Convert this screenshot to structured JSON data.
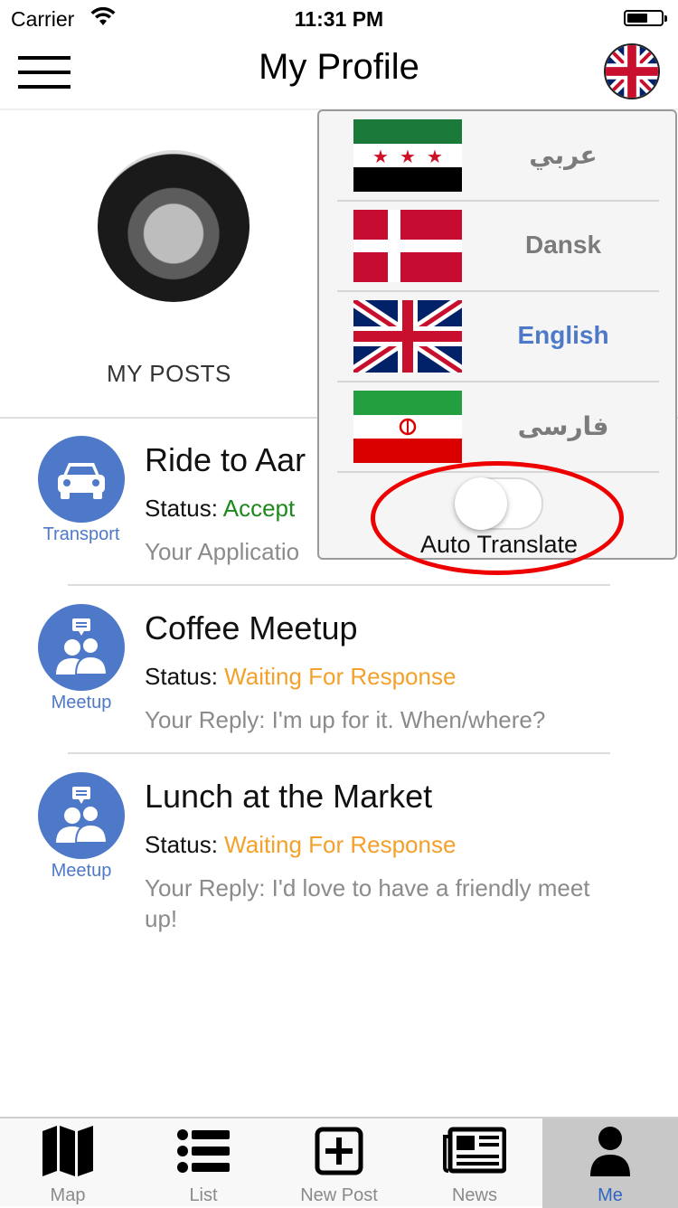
{
  "status_bar": {
    "carrier": "Carrier",
    "time": "11:31 PM"
  },
  "nav": {
    "title": "My Profile",
    "current_language_flag": "uk-flag-icon"
  },
  "profile": {
    "tab_label": "MY POSTS"
  },
  "posts": [
    {
      "category": "Transport",
      "icon": "car-icon",
      "title": "Ride to Aar",
      "status_label": "Status:",
      "status_value": "Accept",
      "status_color": "#1d8a1d",
      "reply": "Your Applicatio"
    },
    {
      "category": "Meetup",
      "icon": "meetup-icon",
      "title": "Coffee Meetup",
      "status_label": "Status:",
      "status_value": "Waiting For Response",
      "status_color": "#f4a12b",
      "reply": "Your Reply: I'm up for it.  When/where?"
    },
    {
      "category": "Meetup",
      "icon": "meetup-icon",
      "title": "Lunch at the Market",
      "status_label": "Status:",
      "status_value": "Waiting For Response",
      "status_color": "#f4a12b",
      "reply": "Your Reply: I'd love to have a friendly meet up!"
    }
  ],
  "language_menu": {
    "languages": [
      {
        "label": "عربي",
        "flag": "syria-flag-icon",
        "selected": false
      },
      {
        "label": "Dansk",
        "flag": "denmark-flag-icon",
        "selected": false
      },
      {
        "label": "English",
        "flag": "uk-flag-icon",
        "selected": true
      },
      {
        "label": "فارسی",
        "flag": "iran-flag-icon",
        "selected": false
      }
    ],
    "auto_translate_label": "Auto Translate",
    "auto_translate_on": false
  },
  "tab_bar": {
    "tabs": [
      {
        "label": "Map",
        "icon": "map-icon",
        "active": false
      },
      {
        "label": "List",
        "icon": "list-icon",
        "active": false
      },
      {
        "label": "New Post",
        "icon": "plus-square-icon",
        "active": false
      },
      {
        "label": "News",
        "icon": "newspaper-icon",
        "active": false
      },
      {
        "label": "Me",
        "icon": "person-icon",
        "active": true
      }
    ]
  },
  "colors": {
    "accent": "#4e79c8",
    "accepted": "#1d8a1d",
    "waiting": "#f4a12b",
    "highlight_ring": "#e00000"
  }
}
